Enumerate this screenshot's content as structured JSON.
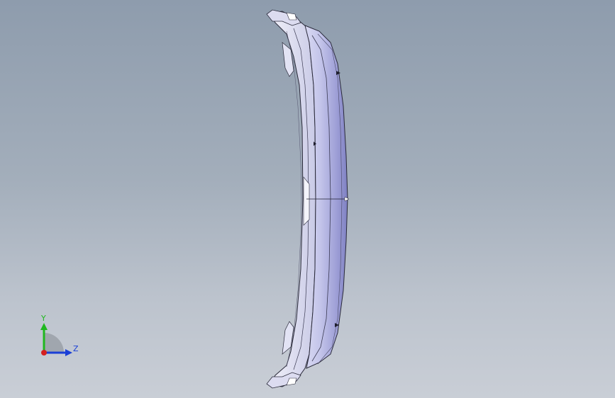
{
  "viewport": {
    "background_top": "#8e9cad",
    "background_bottom": "#c9ced6"
  },
  "model": {
    "fill_color": "#bcbde0",
    "highlight_color": "#e8e9fb",
    "edge_color": "#2a2a3a"
  },
  "triad": {
    "y_label": "Y",
    "z_label": "Z",
    "y_color": "#1fb81f",
    "z_color": "#1a3fd6",
    "x_color": "#d42020",
    "arc_color": "#9aa0a8"
  }
}
